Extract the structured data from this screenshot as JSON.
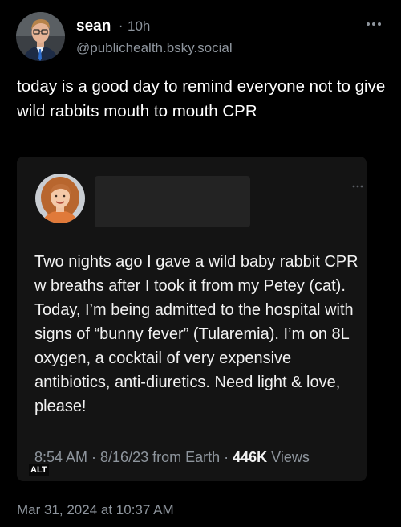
{
  "post": {
    "author_name": "sean",
    "separator": "·",
    "time_ago": "10h",
    "handle": "@publichealth.bsky.social",
    "text": "today is a good day to remind everyone not to give wild rabbits mouth to mouth CPR",
    "timestamp": "Mar 31, 2024 at 10:37 AM",
    "more_icon": "more-horizontal-icon"
  },
  "embed": {
    "text": "Two nights ago I gave a wild baby rabbit CPR w breaths after I took it from my Petey (cat). Today, I’m being admitted to the hospital with signs of “bunny fever” (Tularemia). I’m on 8L oxygen, a cocktail of very expensive antibiotics, anti-diuretics. Need light & love, please!",
    "meta_prefix": "8:54 AM · 8/16/23 from Earth · ",
    "views_count": "446K",
    "views_label": " Views",
    "alt_label": "ALT",
    "more_icon": "more-horizontal-icon"
  },
  "colors": {
    "background": "#000000",
    "text": "#ffffff",
    "secondary_text": "#8e959d",
    "embed_background": "#141414"
  }
}
